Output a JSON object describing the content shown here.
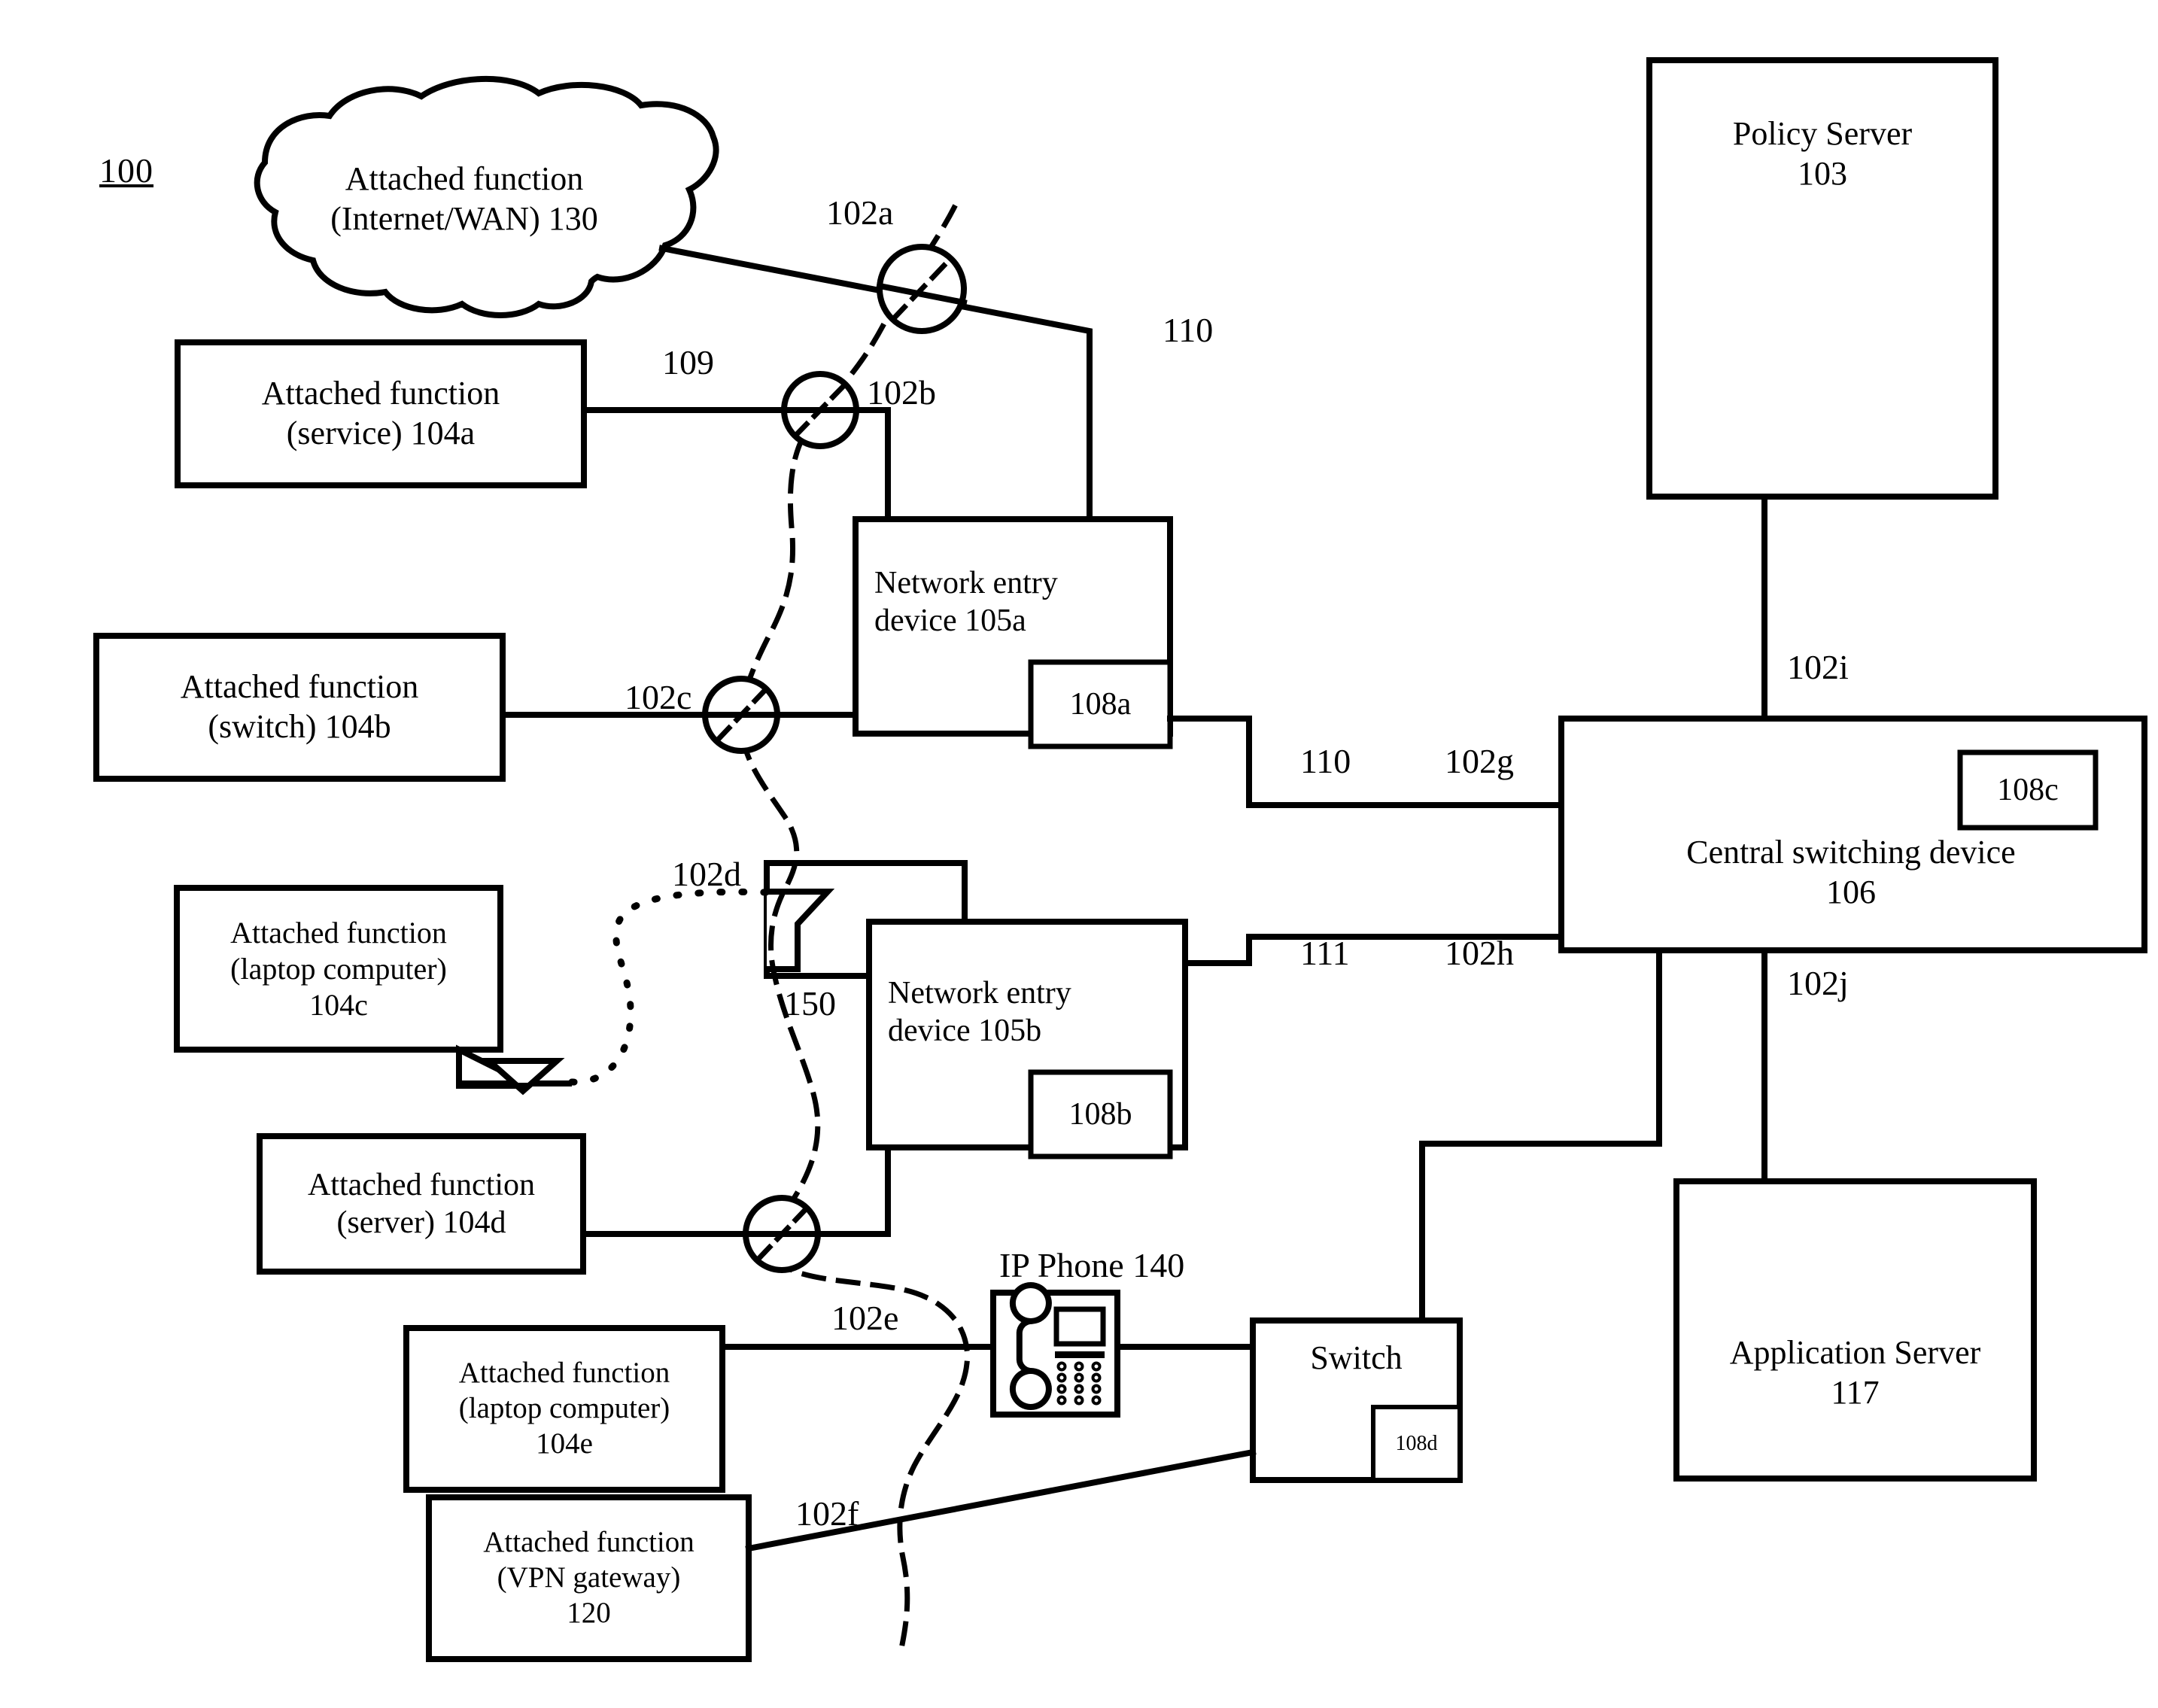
{
  "figure": {
    "number": "100",
    "type": "network architecture block diagram"
  },
  "nodes": {
    "internet_wan": {
      "line1": "Attached function",
      "line2": "(Internet/WAN) 130"
    },
    "af_service": {
      "line1": "Attached function",
      "line2": "(service) 104a"
    },
    "af_switch": {
      "line1": "Attached function",
      "line2": "(switch) 104b"
    },
    "af_laptop_c": {
      "line1": "Attached function",
      "line2": "(laptop computer)",
      "line3": "104c"
    },
    "af_server_d": {
      "line1": "Attached function",
      "line2": "(server) 104d"
    },
    "af_laptop_e": {
      "line1": "Attached function",
      "line2": "(laptop computer)",
      "line3": "104e"
    },
    "af_vpn": {
      "line1": "Attached function",
      "line2": "(VPN gateway)",
      "line3": "120"
    },
    "ned_a": {
      "line1": "Network entry",
      "line2": "device 105a"
    },
    "ned_b": {
      "line1": "Network entry",
      "line2": "device 105b"
    },
    "central_switch": {
      "line1": "Central switching device",
      "line2": "106"
    },
    "policy_server": {
      "line1": "Policy Server",
      "line2": "103"
    },
    "application_server": {
      "line1": "Application Server",
      "line2": "117"
    },
    "switch": {
      "line1": "Switch"
    },
    "ip_phone": {
      "label": "IP Phone 140"
    },
    "ap_150": {
      "label": "150"
    }
  },
  "submodules": {
    "m108a": "108a",
    "m108b": "108b",
    "m108c": "108c",
    "m108d": "108d"
  },
  "link_labels": {
    "l102a": "102a",
    "l102b": "102b",
    "l102c": "102c",
    "l102d": "102d",
    "l102e": "102e",
    "l102f": "102f",
    "l102g": "102g",
    "l102h": "102h",
    "l102i": "102i",
    "l102j": "102j",
    "l109": "109",
    "l110_top": "110",
    "l110_mid": "110",
    "l111": "111"
  },
  "colors": {
    "stroke": "#000000",
    "background": "#ffffff"
  }
}
